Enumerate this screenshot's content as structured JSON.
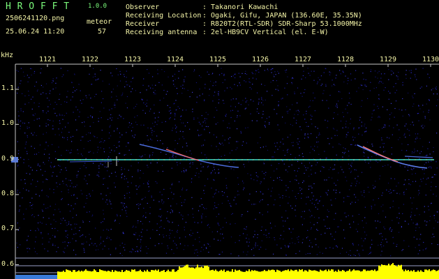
{
  "app": {
    "title": "H R O F F T",
    "version": "1.0.0",
    "filename": "2506241120.png",
    "datetime": "25.06.24 11:20",
    "detection_label": "meteor",
    "detection_count": "57"
  },
  "info": [
    {
      "label": "Observer",
      "value": ": Takanori Kawachi"
    },
    {
      "label": "Receiving Location",
      "value": ": Ogaki, Gifu, JAPAN (136.60E, 35.35N)"
    },
    {
      "label": "Receiver",
      "value": ": R820T2(RTL-SDR) SDR-Sharp 53.1000MHz"
    },
    {
      "label": "Receiving antenna",
      "value": ": 2el-HB9CV Vertical (el. E-W)"
    }
  ],
  "axes": {
    "y_unit": "kHz",
    "x_ticks": [
      "1121",
      "1122",
      "1123",
      "1124",
      "1125",
      "1126",
      "1127",
      "1128",
      "1129",
      "1130"
    ],
    "y_ticks": [
      "1.1",
      "1.0",
      "0.9",
      "0.8",
      "0.7",
      "0.6"
    ]
  },
  "colors": {
    "background": "#000000",
    "text": "#f5f5a8",
    "title": "#7cfc7c",
    "noise": "#1a1a7a",
    "carrier": "#40e0d0",
    "level_bar": "#ffff00"
  }
}
